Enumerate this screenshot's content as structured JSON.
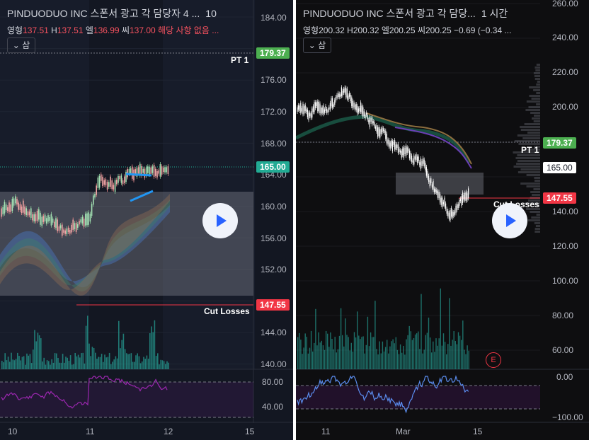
{
  "left_chart": {
    "title": "PINDUODUO INC 스폰서 광고 각 담당자 4 ...",
    "timeframe": "10",
    "ohlc": {
      "o_label": "영형",
      "o": "137.51",
      "h_label": "H",
      "h": "137.51",
      "l_label": "엘",
      "l": "136.99",
      "c_label": "씨",
      "c": "137.00",
      "status": "해당 사항 없음 ..."
    },
    "collapse_label": "삼",
    "price_axis": [
      "184.00",
      "180.00",
      "176.00",
      "172.00",
      "168.00",
      "164.00",
      "160.00",
      "156.00",
      "152.00",
      "148.00",
      "144.00",
      "140.00"
    ],
    "tags": {
      "pt1": "179.37",
      "current": "165.00",
      "stop": "147.55"
    },
    "notes": {
      "pt1": "PT 1",
      "cut": "Cut Losses"
    },
    "rsi_axis": [
      "80.00",
      "40.00"
    ],
    "time_axis": [
      "10",
      "11",
      "12",
      "15"
    ]
  },
  "right_chart": {
    "title": "PINDUODUO INC 스폰서 광고 각 담당...",
    "timeframe": "1 시간",
    "ohlc": {
      "o_label": "영형",
      "o": "200.32",
      "h_label": "H",
      "h": "200.32",
      "l_label": "엘",
      "l": "200.25",
      "c_label": "씨",
      "c": "200.25",
      "chg": "−0.69",
      "chg_pct": "(−0.34 ..."
    },
    "collapse_label": "삼",
    "price_axis": [
      "260.00",
      "240.00",
      "220.00",
      "200.00",
      "180.00",
      "160.00",
      "140.00",
      "120.00",
      "100.00",
      "80.00",
      "60.00"
    ],
    "tags": {
      "pt1": "179.37",
      "current": "165.00",
      "stop": "147.55"
    },
    "notes": {
      "pt1": "PT 1",
      "cut": "Cut Losses"
    },
    "earnings_marker": "E",
    "osc_axis": [
      "0.00",
      "−100.00"
    ],
    "time_axis": [
      "11",
      "Mar",
      "15"
    ]
  },
  "colors": {
    "bg_left": "#131722",
    "bg_right": "#0e0e10",
    "green": "#4caf50",
    "red": "#f23645",
    "teal": "#22ab94",
    "purple": "#9c27b0",
    "blue": "#2962ff"
  }
}
